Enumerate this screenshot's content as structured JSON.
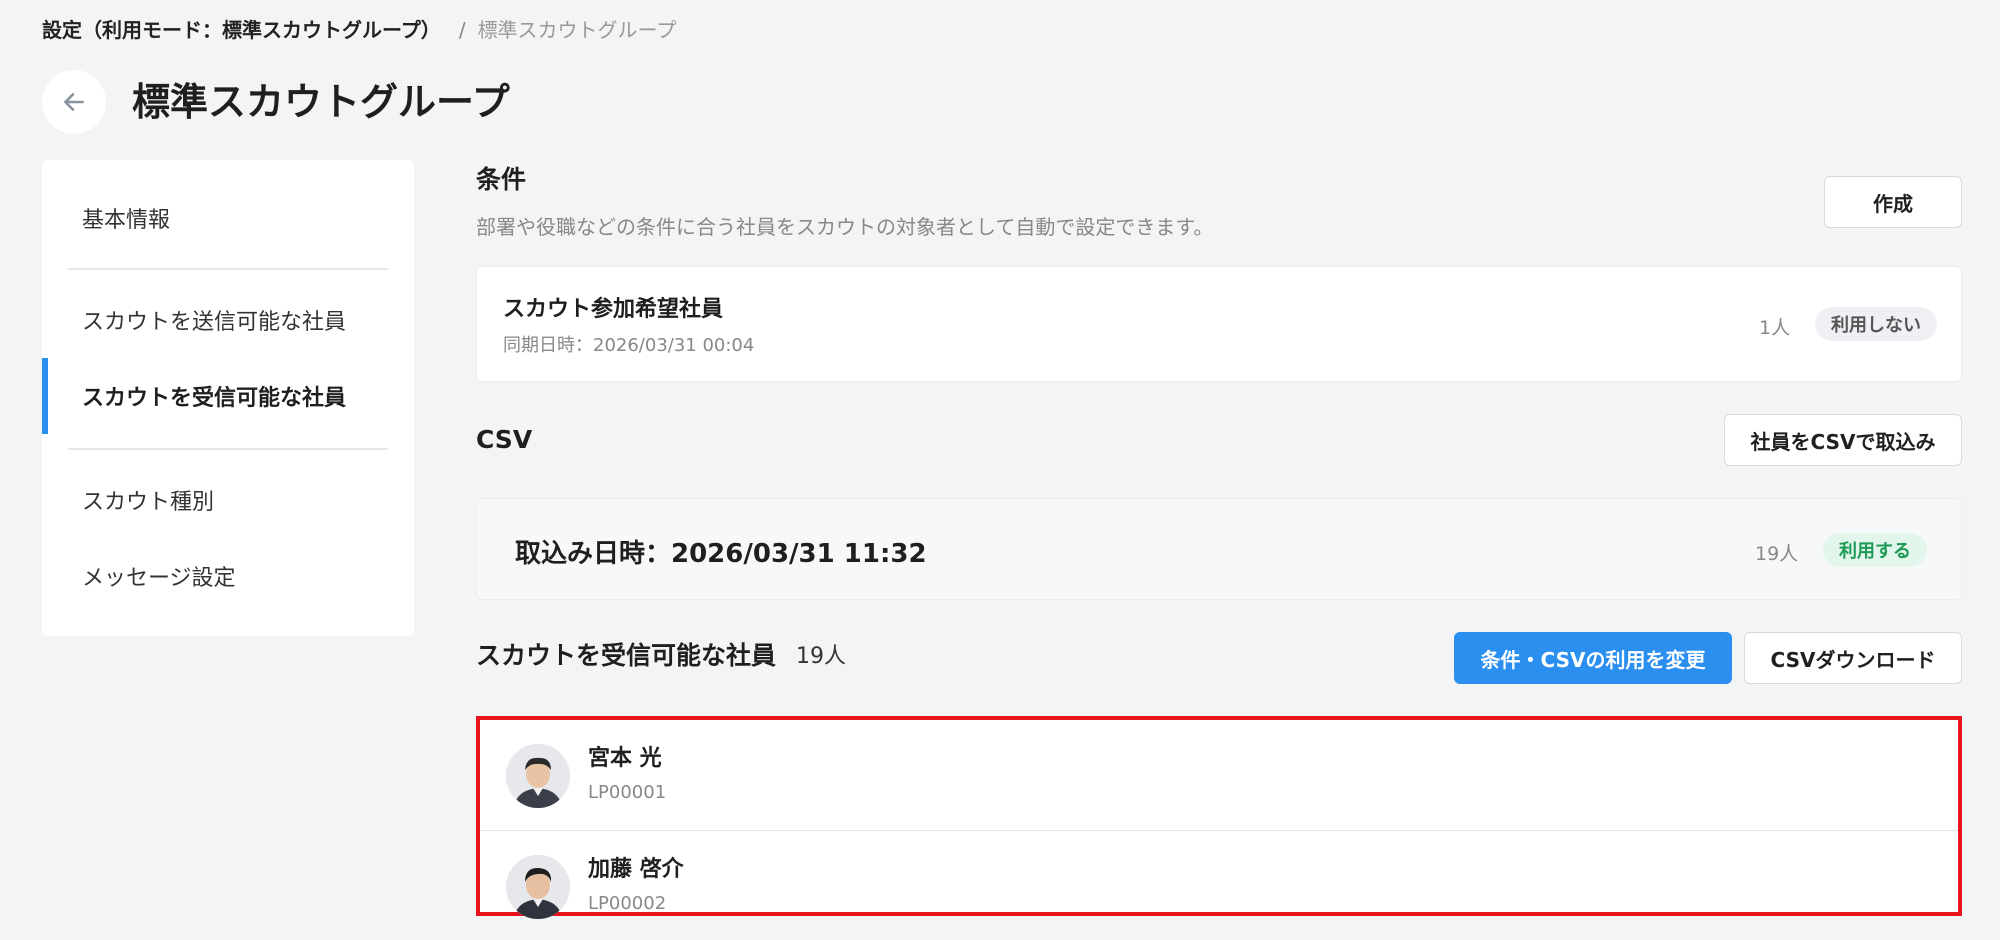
{
  "breadcrumb": {
    "root": "設定（利用モード：標準スカウトグループ）",
    "separator": "/",
    "current": "標準スカウトグループ"
  },
  "header": {
    "back_icon": "arrow-left-icon",
    "title": "標準スカウトグループ"
  },
  "sidebar": {
    "items": [
      {
        "label": "基本情報",
        "active": false
      },
      {
        "label": "スカウトを送信可能な社員",
        "active": false
      },
      {
        "label": "スカウトを受信可能な社員",
        "active": true
      },
      {
        "label": "スカウト種別",
        "active": false
      },
      {
        "label": "メッセージ設定",
        "active": false
      }
    ],
    "accent_color": "#2b8ff0"
  },
  "conditions": {
    "title": "条件",
    "description": "部署や役職などの条件に合う社員をスカウトの対象者として自動で設定できます。",
    "create_label": "作成",
    "item": {
      "name": "スカウト参加希望社員",
      "sync": "同期日時：2026/03/31 00:04",
      "count": "1人",
      "status": "利用しない"
    }
  },
  "csv": {
    "title": "CSV",
    "import_label": "社員をCSVで取込み",
    "item": {
      "date": "取込み日時：2026/03/31 11:32",
      "count": "19人",
      "status": "利用する"
    }
  },
  "employees": {
    "title": "スカウトを受信可能な社員",
    "count": "19人",
    "change_label": "条件・CSVの利用を変更",
    "download_label": "CSVダウンロード",
    "highlight_color": "#e8131b",
    "rows": [
      {
        "name": "宮本 光",
        "id": "LP00001"
      },
      {
        "name": "加藤 啓介",
        "id": "LP00002"
      }
    ]
  }
}
